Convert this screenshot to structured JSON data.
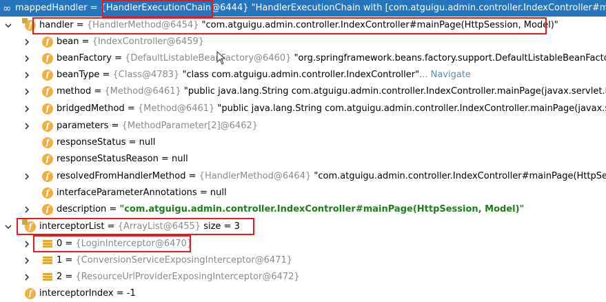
{
  "rows": [
    {
      "id": "r0",
      "name": "mappedHandler",
      "eq": " = ",
      "type": "{HandlerExecutionChain@6444}",
      "value": "\"HandlerExecutionChain with [com.atguigu.admin.controller.IndexController#mainPage(HttpSession, Model)]\""
    },
    {
      "id": "r1",
      "name": "handler",
      "eq": " = ",
      "type": "{HandlerMethod@6454}",
      "value": "\"com.atguigu.admin.controller.IndexController#mainPage(HttpSession, Model)\""
    },
    {
      "id": "r2",
      "name": "bean",
      "eq": " = ",
      "type": "{IndexController@6459}",
      "value": ""
    },
    {
      "id": "r3",
      "name": "beanFactory",
      "eq": " = ",
      "type": "{DefaultListableBeanFactory@6460}",
      "value": "\"org.springframework.beans.factory.support.DefaultListableBeanFactory\""
    },
    {
      "id": "r4",
      "name": "beanType",
      "eq": " = ",
      "type": "{Class@4783}",
      "value": "\"class com.atguigu.admin.controller.IndexController\"",
      "link": "... Navigate"
    },
    {
      "id": "r5",
      "name": "method",
      "eq": " = ",
      "type": "{Method@6461}",
      "value": "\"public java.lang.String com.atguigu.admin.controller.IndexController.mainPage(javax.servlet.http.HttpSession,org.springframework.ui.Model)\""
    },
    {
      "id": "r6",
      "name": "bridgedMethod",
      "eq": " = ",
      "type": "{Method@6461}",
      "value": "\"public java.lang.String com.atguigu.admin.controller.IndexController.mainPage(javax.servlet.http.HttpSession,org.springframework.ui.Model)\""
    },
    {
      "id": "r7",
      "name": "parameters",
      "eq": " = ",
      "type": "{MethodParameter[2]@6462}",
      "value": ""
    },
    {
      "id": "r8",
      "name": "responseStatus",
      "eq": " = ",
      "type": "",
      "value": "null"
    },
    {
      "id": "r9",
      "name": "responseStatusReason",
      "eq": " = ",
      "type": "",
      "value": "null"
    },
    {
      "id": "r10",
      "name": "resolvedFromHandlerMethod",
      "eq": " = ",
      "type": "{HandlerMethod@6464}",
      "value": "\"com.atguigu.admin.controller.IndexController#mainPage(HttpSession, Model)\""
    },
    {
      "id": "r11",
      "name": "interfaceParameterAnnotations",
      "eq": " = ",
      "type": "",
      "value": "null"
    },
    {
      "id": "r12",
      "name": "description",
      "eq": " = ",
      "type": "",
      "value": "\"com.atguigu.admin.controller.IndexController#mainPage(HttpSession, Model)\""
    },
    {
      "id": "r13",
      "name": "interceptorList",
      "eq": " = ",
      "type": "{ArrayList@6455}",
      "value": "size = 3"
    },
    {
      "id": "r14",
      "name": "0",
      "eq": " = ",
      "type": "{LoginInterceptor@6470}",
      "value": ""
    },
    {
      "id": "r15",
      "name": "1",
      "eq": " = ",
      "type": "{ConversionServiceExposingInterceptor@6471}",
      "value": ""
    },
    {
      "id": "r16",
      "name": "2",
      "eq": " = ",
      "type": "{ResourceUrlProviderExposingInterceptor@6472}",
      "value": ""
    },
    {
      "id": "r17",
      "name": "interceptorIndex",
      "eq": " = ",
      "type": "",
      "value": "-1"
    }
  ],
  "colors": {
    "selection": "#2675bf",
    "highlight": "#e8191a",
    "field_icon": "#f0b040",
    "string_bold": "#1e7e1e"
  },
  "icons": {
    "watch": "infinity-icon",
    "field": "field-icon",
    "list_element": "list-element-icon",
    "expand": "chevron-right-icon",
    "collapse": "chevron-down-icon"
  }
}
